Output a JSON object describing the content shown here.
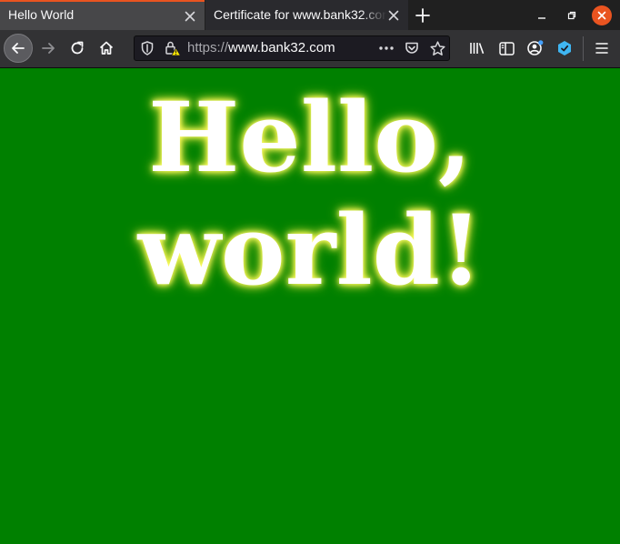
{
  "tabs": [
    {
      "title": "Hello World",
      "active": true
    },
    {
      "title": "Certificate for www.bank32.com",
      "active": false
    }
  ],
  "toolbar": {
    "url_scheme": "https://",
    "url_host": "www.bank32.com"
  },
  "content": {
    "line1": "Hello,",
    "line2": "world!"
  },
  "colors": {
    "page_background": "#008000",
    "text": "#ffffff",
    "glow": "#ffff66",
    "window_accent": "#e95420"
  },
  "icons": {
    "tab_close": "close-icon",
    "new_tab": "plus-icon",
    "back": "arrow-left-icon",
    "forward": "arrow-right-icon",
    "reload": "reload-icon",
    "home": "home-icon",
    "tracking": "shield-icon",
    "security": "lock-warning-icon",
    "page_actions": "more-dots-icon",
    "pocket": "pocket-icon",
    "bookmark": "star-icon",
    "library": "library-icon",
    "sidebar": "sidebar-icon",
    "account": "account-icon",
    "extension": "extension-icon",
    "menu": "hamburger-menu-icon"
  }
}
